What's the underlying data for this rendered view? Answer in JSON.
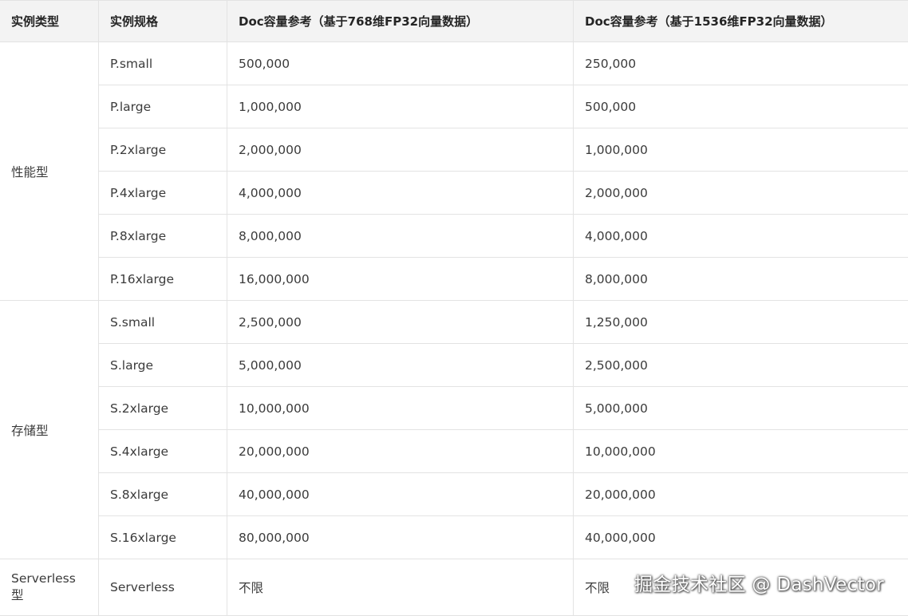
{
  "headers": [
    "实例类型",
    "实例规格",
    "Doc容量参考（基于768维FP32向量数据）",
    "Doc容量参考（基于1536维FP32向量数据）"
  ],
  "groups": [
    {
      "type": "性能型",
      "rows": [
        {
          "spec": "P.small",
          "cap768": "500,000",
          "cap1536": "250,000"
        },
        {
          "spec": "P.large",
          "cap768": "1,000,000",
          "cap1536": "500,000"
        },
        {
          "spec": "P.2xlarge",
          "cap768": "2,000,000",
          "cap1536": "1,000,000"
        },
        {
          "spec": "P.4xlarge",
          "cap768": "4,000,000",
          "cap1536": "2,000,000"
        },
        {
          "spec": "P.8xlarge",
          "cap768": "8,000,000",
          "cap1536": "4,000,000"
        },
        {
          "spec": "P.16xlarge",
          "cap768": "16,000,000",
          "cap1536": "8,000,000"
        }
      ]
    },
    {
      "type": "存储型",
      "rows": [
        {
          "spec": "S.small",
          "cap768": "2,500,000",
          "cap1536": "1,250,000"
        },
        {
          "spec": "S.large",
          "cap768": "5,000,000",
          "cap1536": "2,500,000"
        },
        {
          "spec": "S.2xlarge",
          "cap768": "10,000,000",
          "cap1536": "5,000,000"
        },
        {
          "spec": "S.4xlarge",
          "cap768": "20,000,000",
          "cap1536": "10,000,000"
        },
        {
          "spec": "S.8xlarge",
          "cap768": "40,000,000",
          "cap1536": "20,000,000"
        },
        {
          "spec": "S.16xlarge",
          "cap768": "80,000,000",
          "cap1536": "40,000,000"
        }
      ]
    },
    {
      "type": "Serverless型",
      "rows": [
        {
          "spec": "Serverless",
          "cap768": "不限",
          "cap1536": "不限"
        }
      ]
    }
  ],
  "watermark": "掘金技术社区 @ DashVector"
}
